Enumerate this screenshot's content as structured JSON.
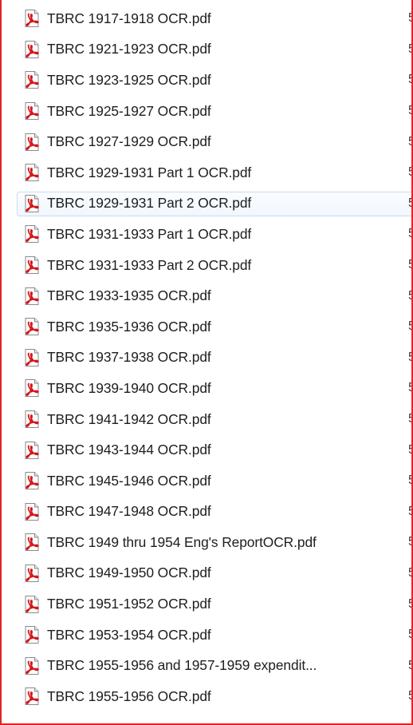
{
  "file_list": {
    "accent_border": "#e02424",
    "icon": "pdf-file-icon",
    "selected_index": 6,
    "items": [
      {
        "name": "TBRC 1917-1918 OCR.pdf",
        "trail": "5"
      },
      {
        "name": "TBRC 1921-1923 OCR.pdf",
        "trail": "5"
      },
      {
        "name": "TBRC 1923-1925 OCR.pdf",
        "trail": "5"
      },
      {
        "name": "TBRC 1925-1927 OCR.pdf",
        "trail": "5"
      },
      {
        "name": "TBRC 1927-1929 OCR.pdf",
        "trail": "5"
      },
      {
        "name": "TBRC 1929-1931 Part 1 OCR.pdf",
        "trail": "5"
      },
      {
        "name": "TBRC 1929-1931 Part 2 OCR.pdf",
        "trail": "5"
      },
      {
        "name": "TBRC 1931-1933 Part 1 OCR.pdf",
        "trail": "5"
      },
      {
        "name": "TBRC 1931-1933 Part 2 OCR.pdf",
        "trail": "5"
      },
      {
        "name": "TBRC 1933-1935 OCR.pdf",
        "trail": "5"
      },
      {
        "name": "TBRC 1935-1936 OCR.pdf",
        "trail": "5"
      },
      {
        "name": "TBRC 1937-1938 OCR.pdf",
        "trail": "5"
      },
      {
        "name": "TBRC 1939-1940 OCR.pdf",
        "trail": "5"
      },
      {
        "name": "TBRC 1941-1942 OCR.pdf",
        "trail": "5"
      },
      {
        "name": "TBRC 1943-1944 OCR.pdf",
        "trail": "5"
      },
      {
        "name": "TBRC 1945-1946 OCR.pdf",
        "trail": "5"
      },
      {
        "name": "TBRC 1947-1948 OCR.pdf",
        "trail": "5"
      },
      {
        "name": "TBRC 1949 thru 1954 Eng's ReportOCR.pdf",
        "trail": "5"
      },
      {
        "name": "TBRC 1949-1950 OCR.pdf",
        "trail": "5"
      },
      {
        "name": "TBRC 1951-1952 OCR.pdf",
        "trail": "5"
      },
      {
        "name": "TBRC 1953-1954 OCR.pdf",
        "trail": "5"
      },
      {
        "name": "TBRC 1955-1956 and 1957-1959 expendit...",
        "trail": "5"
      },
      {
        "name": "TBRC 1955-1956 OCR.pdf",
        "trail": "5"
      }
    ]
  }
}
